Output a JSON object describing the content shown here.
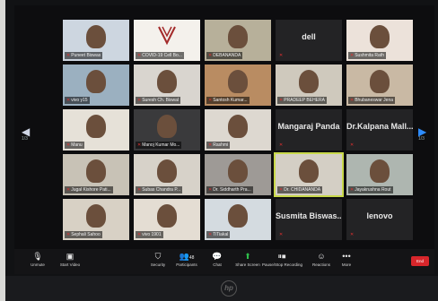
{
  "app": {
    "accent": "#2d8cff",
    "end_color": "#d8262b"
  },
  "navigation": {
    "page_left": "1/3",
    "page_right": "1/3"
  },
  "tiles": [
    {
      "name": "Puneet Biswas",
      "kind": "video",
      "bg": "#cdd6e0"
    },
    {
      "name": "COVID-19 Cell Bo...",
      "kind": "logo",
      "bg": "#f4f1ec"
    },
    {
      "name": "DEBANANDA",
      "kind": "video",
      "bg": "#b7b09a"
    },
    {
      "name": "dell",
      "kind": "text",
      "bg": "#232325"
    },
    {
      "name": "Sushmita Rath",
      "kind": "video",
      "bg": "#ece2da"
    },
    {
      "name": "vivo y15",
      "kind": "video",
      "bg": "#9bb0c0"
    },
    {
      "name": "Suresh Ch. Biswal",
      "kind": "video",
      "bg": "#d9d5cf"
    },
    {
      "name": "Santosh Kumar...",
      "kind": "video",
      "bg": "#b98c62"
    },
    {
      "name": "PRADEEP BEHERA",
      "kind": "video",
      "bg": "#cfc9bd"
    },
    {
      "name": "Bhubaneswar Jena",
      "kind": "video",
      "bg": "#c9b9a4"
    },
    {
      "name": "Manu",
      "kind": "video",
      "bg": "#e6e1d8"
    },
    {
      "name": "Manoj Kumar Mo...",
      "kind": "video",
      "bg": "#3a3a3c"
    },
    {
      "name": "Rashmi",
      "kind": "video",
      "bg": "#ddd8d0"
    },
    {
      "name": "Mangaraj Panda",
      "kind": "text",
      "bg": "#232325"
    },
    {
      "name": "Dr.Kalpana Mall...",
      "kind": "text",
      "bg": "#232325"
    },
    {
      "name": "Jugal Kishore Pati...",
      "kind": "video",
      "bg": "#c8c2b6"
    },
    {
      "name": "Subas Chandra P...",
      "kind": "video",
      "bg": "#d7d2c9"
    },
    {
      "name": "Dr. Siddharth Pra...",
      "kind": "video",
      "bg": "#9e9a96"
    },
    {
      "name": "Dr. CHIDANANDA",
      "kind": "video",
      "bg": "#d4cfc5",
      "active": true
    },
    {
      "name": "Jayakrushna Rout",
      "kind": "video",
      "bg": "#aeb6b0"
    },
    {
      "name": "Sephali Sahoo",
      "kind": "video",
      "bg": "#d8d1c5"
    },
    {
      "name": "vivo 1901",
      "kind": "video",
      "bg": "#e4ddd3"
    },
    {
      "name": "TiTiakal",
      "kind": "video",
      "bg": "#d4dbe0"
    },
    {
      "name": "Susmita Biswas...",
      "kind": "text",
      "bg": "#232325"
    },
    {
      "name": "lenovo",
      "kind": "text",
      "bg": "#232325"
    }
  ],
  "toolbar": {
    "unmute": "Unmute",
    "start_video": "Start Video",
    "security": "Security",
    "participants": "Participants",
    "participants_count": "48",
    "chat": "Chat",
    "share_screen": "Share Screen",
    "pause_recording": "Pause/Stop Recording",
    "reactions": "Reactions",
    "more": "More",
    "end": "End"
  },
  "hardware": {
    "brand_logo": "hp"
  }
}
